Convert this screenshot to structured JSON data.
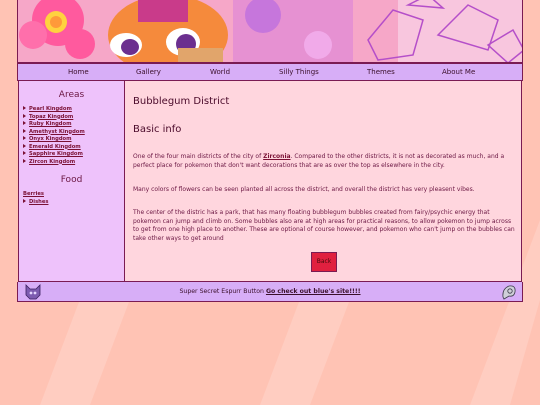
{
  "nav": {
    "items": [
      "Home",
      "Gallery",
      "World",
      "Silly Things",
      "Themes",
      "About Me"
    ]
  },
  "sidebar": {
    "areas_title": "Areas",
    "areas": [
      "Pearl Kingdom",
      "Topaz Kingdom",
      "Ruby Kingdom",
      "Amethyst Kingdom",
      "Onyx Kingdom",
      "Emerald Kingdom",
      "Sapphire Kingdom",
      "Zircon Kingdom"
    ],
    "food_title": "Food",
    "food_link": "Berries",
    "food_items": [
      "Dishes"
    ]
  },
  "main": {
    "title": "Bubblegum District",
    "subtitle": "Basic info",
    "p1_before": "One of the four main districts of the city of ",
    "p1_link": "Zirconia",
    "p1_after": ". Compared to the other districts, it is not as decorated as much, and a perfect place for pokemon that don't want decorations that are as over the top as elsewhere in the city.",
    "p2": "Many colors of flowers can be seen planted all across the district, and overall the district has very pleasent vibes.",
    "p3": "The center of the distric has a park, that has many floating bubblegum bubbles created from fairy/psychic energy that pokemon can jump and climb on. Some bubbles also are at high areas for practical reasons, to allow pokemon to jump across to get from one high place to another. These are optional of course however, and pokemon who can't jump on the bubbles can take other ways to get around",
    "back_label": "Back"
  },
  "footer": {
    "text": "Super Secret Espurr Button ",
    "link": "Go check out blue's site!!!!"
  },
  "colors": {
    "background": "#ffc3b4",
    "nav_bg": "#d7aef7",
    "sidebar_bg": "#eec2fb",
    "main_bg": "#ffd6de",
    "border": "#7a1b53",
    "button": "#e0203f"
  },
  "icons": [
    "espurr-sprite-icon",
    "spiral-shell-sprite-icon"
  ]
}
